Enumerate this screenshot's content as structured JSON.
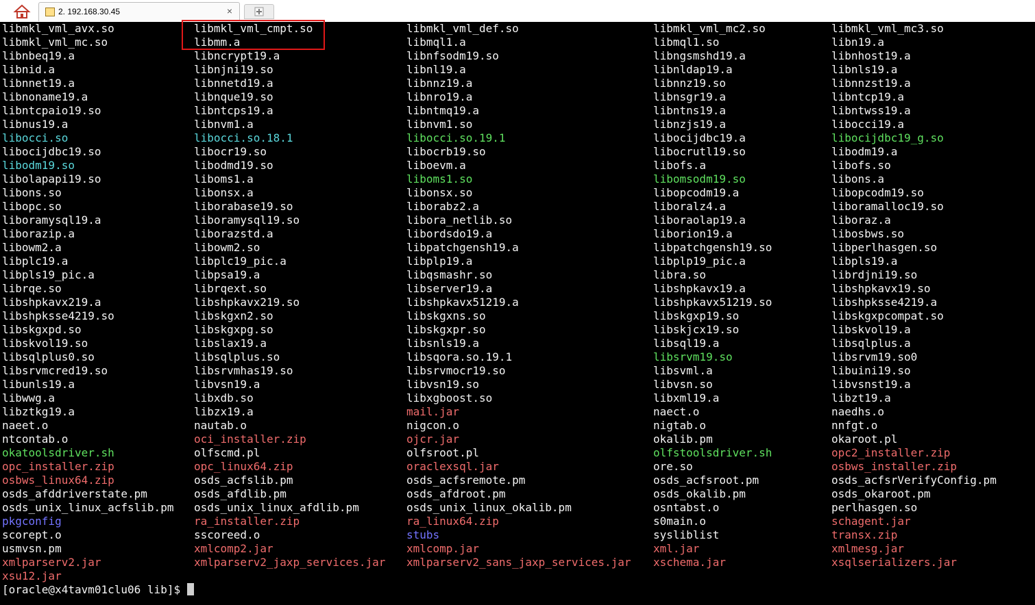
{
  "window": {
    "tab_title": "2. 192.168.30.45",
    "close_glyph": "×",
    "home_icon": "home-icon",
    "new_tab_icon": "plus-icon"
  },
  "colors": {
    "background": "#000000",
    "normal": "#f4f4f4",
    "symlink": "#5ad8dc",
    "executable": "#5fe15f",
    "archive": "#f06c6c",
    "directory": "#7373ff",
    "highlight_box": "#e01818"
  },
  "listing": {
    "columns": 5,
    "files": [
      [
        "libmkl_vml_avx.so",
        "normal"
      ],
      [
        "libmkl_vml_cmpt.so",
        "normal"
      ],
      [
        "libmkl_vml_def.so",
        "normal"
      ],
      [
        "libmkl_vml_mc2.so",
        "normal"
      ],
      [
        "libmkl_vml_mc3.so",
        "normal"
      ],
      [
        "libmkl_vml_mc.so",
        "normal"
      ],
      [
        "libmm.a",
        "normal"
      ],
      [
        "libmql1.a",
        "normal"
      ],
      [
        "libmql1.so",
        "normal"
      ],
      [
        "libn19.a",
        "normal"
      ],
      [
        "libnbeq19.a",
        "normal"
      ],
      [
        "libncrypt19.a",
        "normal"
      ],
      [
        "libnfsodm19.so",
        "normal"
      ],
      [
        "libngsmshd19.a",
        "normal"
      ],
      [
        "libnhost19.a",
        "normal"
      ],
      [
        "libnid.a",
        "normal"
      ],
      [
        "libnjni19.so",
        "normal"
      ],
      [
        "libnl19.a",
        "normal"
      ],
      [
        "libnldap19.a",
        "normal"
      ],
      [
        "libnls19.a",
        "normal"
      ],
      [
        "libnnet19.a",
        "normal"
      ],
      [
        "libnnetd19.a",
        "normal"
      ],
      [
        "libnnz19.a",
        "normal"
      ],
      [
        "libnnz19.so",
        "normal"
      ],
      [
        "libnnzst19.a",
        "normal"
      ],
      [
        "libnoname19.a",
        "normal"
      ],
      [
        "libnque19.so",
        "normal"
      ],
      [
        "libnro19.a",
        "normal"
      ],
      [
        "libnsgr19.a",
        "normal"
      ],
      [
        "libntcp19.a",
        "normal"
      ],
      [
        "libntcpaio19.so",
        "normal"
      ],
      [
        "libntcps19.a",
        "normal"
      ],
      [
        "libntmq19.a",
        "normal"
      ],
      [
        "libntns19.a",
        "normal"
      ],
      [
        "libntwss19.a",
        "normal"
      ],
      [
        "libnus19.a",
        "normal"
      ],
      [
        "libnvm1.a",
        "normal"
      ],
      [
        "libnvm1.so",
        "normal"
      ],
      [
        "libnzjs19.a",
        "normal"
      ],
      [
        "libocci19.a",
        "normal"
      ],
      [
        "libocci.so",
        "link"
      ],
      [
        "libocci.so.18.1",
        "link"
      ],
      [
        "libocci.so.19.1",
        "exec"
      ],
      [
        "libocijdbc19.a",
        "normal"
      ],
      [
        "libocijdbc19_g.so",
        "exec"
      ],
      [
        "libocijdbc19.so",
        "normal"
      ],
      [
        "libocr19.so",
        "normal"
      ],
      [
        "libocrb19.so",
        "normal"
      ],
      [
        "libocrutl19.so",
        "normal"
      ],
      [
        "libodm19.a",
        "normal"
      ],
      [
        "libodm19.so",
        "link"
      ],
      [
        "libodmd19.so",
        "normal"
      ],
      [
        "liboevm.a",
        "normal"
      ],
      [
        "libofs.a",
        "normal"
      ],
      [
        "libofs.so",
        "normal"
      ],
      [
        "libolapapi19.so",
        "normal"
      ],
      [
        "liboms1.a",
        "normal"
      ],
      [
        "liboms1.so",
        "exec"
      ],
      [
        "libomsodm19.so",
        "exec"
      ],
      [
        "libons.a",
        "normal"
      ],
      [
        "libons.so",
        "normal"
      ],
      [
        "libonsx.a",
        "normal"
      ],
      [
        "libonsx.so",
        "normal"
      ],
      [
        "libopcodm19.a",
        "normal"
      ],
      [
        "libopcodm19.so",
        "normal"
      ],
      [
        "libopc.so",
        "normal"
      ],
      [
        "liborabase19.so",
        "normal"
      ],
      [
        "liborabz2.a",
        "normal"
      ],
      [
        "liboralz4.a",
        "normal"
      ],
      [
        "liboramalloc19.so",
        "normal"
      ],
      [
        "liboramysql19.a",
        "normal"
      ],
      [
        "liboramysql19.so",
        "normal"
      ],
      [
        "libora_netlib.so",
        "normal"
      ],
      [
        "liboraolap19.a",
        "normal"
      ],
      [
        "liboraz.a",
        "normal"
      ],
      [
        "liborazip.a",
        "normal"
      ],
      [
        "liborazstd.a",
        "normal"
      ],
      [
        "libordsdo19.a",
        "normal"
      ],
      [
        "liborion19.a",
        "normal"
      ],
      [
        "libosbws.so",
        "normal"
      ],
      [
        "libowm2.a",
        "normal"
      ],
      [
        "libowm2.so",
        "normal"
      ],
      [
        "libpatchgensh19.a",
        "normal"
      ],
      [
        "libpatchgensh19.so",
        "normal"
      ],
      [
        "libperlhasgen.so",
        "normal"
      ],
      [
        "libplc19.a",
        "normal"
      ],
      [
        "libplc19_pic.a",
        "normal"
      ],
      [
        "libplp19.a",
        "normal"
      ],
      [
        "libplp19_pic.a",
        "normal"
      ],
      [
        "libpls19.a",
        "normal"
      ],
      [
        "libpls19_pic.a",
        "normal"
      ],
      [
        "libpsa19.a",
        "normal"
      ],
      [
        "libqsmashr.so",
        "normal"
      ],
      [
        "libra.so",
        "normal"
      ],
      [
        "librdjni19.so",
        "normal"
      ],
      [
        "librqe.so",
        "normal"
      ],
      [
        "librqext.so",
        "normal"
      ],
      [
        "libserver19.a",
        "normal"
      ],
      [
        "libshpkavx19.a",
        "normal"
      ],
      [
        "libshpkavx19.so",
        "normal"
      ],
      [
        "libshpkavx219.a",
        "normal"
      ],
      [
        "libshpkavx219.so",
        "normal"
      ],
      [
        "libshpkavx51219.a",
        "normal"
      ],
      [
        "libshpkavx51219.so",
        "normal"
      ],
      [
        "libshpksse4219.a",
        "normal"
      ],
      [
        "libshpksse4219.so",
        "normal"
      ],
      [
        "libskgxn2.so",
        "normal"
      ],
      [
        "libskgxns.so",
        "normal"
      ],
      [
        "libskgxp19.so",
        "normal"
      ],
      [
        "libskgxpcompat.so",
        "normal"
      ],
      [
        "libskgxpd.so",
        "normal"
      ],
      [
        "libskgxpg.so",
        "normal"
      ],
      [
        "libskgxpr.so",
        "normal"
      ],
      [
        "libskjcx19.so",
        "normal"
      ],
      [
        "libskvol19.a",
        "normal"
      ],
      [
        "libskvol19.so",
        "normal"
      ],
      [
        "libslax19.a",
        "normal"
      ],
      [
        "libsnls19.a",
        "normal"
      ],
      [
        "libsql19.a",
        "normal"
      ],
      [
        "libsqlplus.a",
        "normal"
      ],
      [
        "libsqlplus0.so",
        "normal"
      ],
      [
        "libsqlplus.so",
        "normal"
      ],
      [
        "libsqora.so.19.1",
        "normal"
      ],
      [
        "libsrvm19.so",
        "exec"
      ],
      [
        "libsrvm19.so0",
        "normal"
      ],
      [
        "libsrvmcred19.so",
        "normal"
      ],
      [
        "libsrvmhas19.so",
        "normal"
      ],
      [
        "libsrvmocr19.so",
        "normal"
      ],
      [
        "libsvml.a",
        "normal"
      ],
      [
        "libuini19.so",
        "normal"
      ],
      [
        "libunls19.a",
        "normal"
      ],
      [
        "libvsn19.a",
        "normal"
      ],
      [
        "libvsn19.so",
        "normal"
      ],
      [
        "libvsn.so",
        "normal"
      ],
      [
        "libvsnst19.a",
        "normal"
      ],
      [
        "libwwg.a",
        "normal"
      ],
      [
        "libxdb.so",
        "normal"
      ],
      [
        "libxgboost.so",
        "normal"
      ],
      [
        "libxml19.a",
        "normal"
      ],
      [
        "libzt19.a",
        "normal"
      ],
      [
        "libztkg19.a",
        "normal"
      ],
      [
        "libzx19.a",
        "normal"
      ],
      [
        "mail.jar",
        "archive"
      ],
      [
        "naect.o",
        "normal"
      ],
      [
        "naedhs.o",
        "normal"
      ],
      [
        "naeet.o",
        "normal"
      ],
      [
        "nautab.o",
        "normal"
      ],
      [
        "nigcon.o",
        "normal"
      ],
      [
        "nigtab.o",
        "normal"
      ],
      [
        "nnfgt.o",
        "normal"
      ],
      [
        "ntcontab.o",
        "normal"
      ],
      [
        "oci_installer.zip",
        "archive"
      ],
      [
        "ojcr.jar",
        "archive"
      ],
      [
        "okalib.pm",
        "normal"
      ],
      [
        "okaroot.pl",
        "normal"
      ],
      [
        "okatoolsdriver.sh",
        "exec"
      ],
      [
        "olfscmd.pl",
        "normal"
      ],
      [
        "olfsroot.pl",
        "normal"
      ],
      [
        "olfstoolsdriver.sh",
        "exec"
      ],
      [
        "opc2_installer.zip",
        "archive"
      ],
      [
        "opc_installer.zip",
        "archive"
      ],
      [
        "opc_linux64.zip",
        "archive"
      ],
      [
        "oraclexsql.jar",
        "archive"
      ],
      [
        "ore.so",
        "normal"
      ],
      [
        "osbws_installer.zip",
        "archive"
      ],
      [
        "osbws_linux64.zip",
        "archive"
      ],
      [
        "osds_acfslib.pm",
        "normal"
      ],
      [
        "osds_acfsremote.pm",
        "normal"
      ],
      [
        "osds_acfsroot.pm",
        "normal"
      ],
      [
        "osds_acfsrVerifyConfig.pm",
        "normal"
      ],
      [
        "osds_afddriverstate.pm",
        "normal"
      ],
      [
        "osds_afdlib.pm",
        "normal"
      ],
      [
        "osds_afdroot.pm",
        "normal"
      ],
      [
        "osds_okalib.pm",
        "normal"
      ],
      [
        "osds_okaroot.pm",
        "normal"
      ],
      [
        "osds_unix_linux_acfslib.pm",
        "normal"
      ],
      [
        "osds_unix_linux_afdlib.pm",
        "normal"
      ],
      [
        "osds_unix_linux_okalib.pm",
        "normal"
      ],
      [
        "osntabst.o",
        "normal"
      ],
      [
        "perlhasgen.so",
        "normal"
      ],
      [
        "pkgconfig",
        "dir"
      ],
      [
        "ra_installer.zip",
        "archive"
      ],
      [
        "ra_linux64.zip",
        "archive"
      ],
      [
        "s0main.o",
        "normal"
      ],
      [
        "schagent.jar",
        "archive"
      ],
      [
        "scorept.o",
        "normal"
      ],
      [
        "sscoreed.o",
        "normal"
      ],
      [
        "stubs",
        "dir"
      ],
      [
        "sysliblist",
        "normal"
      ],
      [
        "transx.zip",
        "archive"
      ],
      [
        "usmvsn.pm",
        "normal"
      ],
      [
        "xmlcomp2.jar",
        "archive"
      ],
      [
        "xmlcomp.jar",
        "archive"
      ],
      [
        "xml.jar",
        "archive"
      ],
      [
        "xmlmesg.jar",
        "archive"
      ],
      [
        "xmlparserv2.jar",
        "archive"
      ],
      [
        "xmlparserv2_jaxp_services.jar",
        "archive"
      ],
      [
        "xmlparserv2_sans_jaxp_services.jar",
        "archive"
      ],
      [
        "xschema.jar",
        "archive"
      ],
      [
        "xsqlserializers.jar",
        "archive"
      ],
      [
        "xsu12.jar",
        "archive"
      ]
    ]
  },
  "prompt": {
    "text": "[oracle@x4tavm01clu06 lib]$ "
  }
}
